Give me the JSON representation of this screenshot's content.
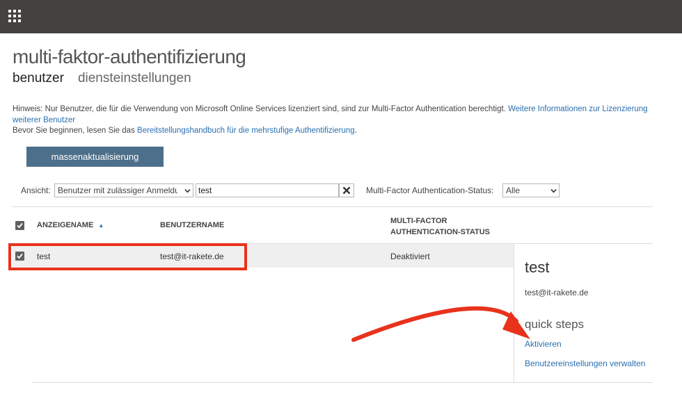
{
  "header": {
    "launcher_icon": "waffle-grid-icon",
    "background": "#444240"
  },
  "page": {
    "title": "multi-faktor-authentifizierung",
    "tabs": [
      {
        "label": "benutzer",
        "active": true
      },
      {
        "label": "diensteinstellungen",
        "active": false
      }
    ]
  },
  "notice": {
    "line1_text": "Hinweis: Nur Benutzer, die für die Verwendung von Microsoft Online Services lizenziert sind, sind zur Multi-Factor Authentication berechtigt.",
    "line1_link": "Weitere Informationen zur Lizenzierung weiterer Benutzer",
    "line2_text": "Bevor Sie beginnen, lesen Sie das",
    "line2_link": "Bereitstellungshandbuch für die mehrstufige Authentifizierung",
    "line2_end": "."
  },
  "toolbar": {
    "bulk_update_label": "massenaktualisierung"
  },
  "filters": {
    "view_label": "Ansicht:",
    "view_value": "Benutzer mit zulässiger Anmeldung",
    "search_value": "test",
    "clear_icon": "close-x-icon",
    "status_label": "Multi-Factor Authentication-Status:",
    "status_value": "Alle"
  },
  "table": {
    "columns": {
      "display_name": "ANZEIGENAME",
      "sort_indicator": "▲",
      "user_name": "BENUTZERNAME",
      "mfa_status_line1": "MULTI-FACTOR",
      "mfa_status_line2": "AUTHENTICATION-STATUS"
    },
    "rows": [
      {
        "display_name": "test",
        "user_name": "test@it-rakete.de",
        "mfa_status": "Deaktiviert",
        "selected": true
      }
    ]
  },
  "detail": {
    "name": "test",
    "email": "test@it-rakete.de",
    "quick_steps_title": "quick steps",
    "actions": [
      "Aktivieren",
      "Benutzereinstellungen verwalten"
    ]
  },
  "annotation": {
    "color": "#e8321c"
  },
  "colors": {
    "link": "#2a6fb0",
    "button": "#4e6f8a",
    "row_bg": "#efefef"
  }
}
